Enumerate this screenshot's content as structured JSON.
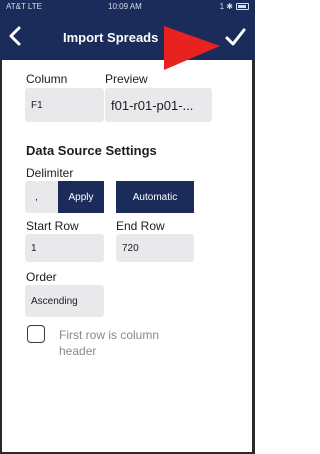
{
  "status_bar": {
    "carrier": "AT&T  LTE",
    "time": "10:09 AM",
    "right": "1 ✱ "
  },
  "header": {
    "title": "Import Spreads"
  },
  "column": {
    "label": "Column",
    "value": "F1"
  },
  "preview": {
    "label": "Preview",
    "value": "f01-r01-p01-..."
  },
  "data_source": {
    "section_title": "Data Source Settings",
    "delimiter_label": "Delimiter",
    "delimiter_value": ",",
    "apply_label": "Apply",
    "automatic_label": "Automatic",
    "start_row_label": "Start Row",
    "start_row_value": "1",
    "end_row_label": "End Row",
    "end_row_value": "720",
    "order_label": "Order",
    "order_value": "Ascending",
    "header_checkbox_label": "First row is column header",
    "header_checkbox_checked": false
  },
  "colors": {
    "header_bg": "#1b2c5a",
    "accent_arrow": "#e8231f",
    "field_bg": "#e9e9ec"
  }
}
